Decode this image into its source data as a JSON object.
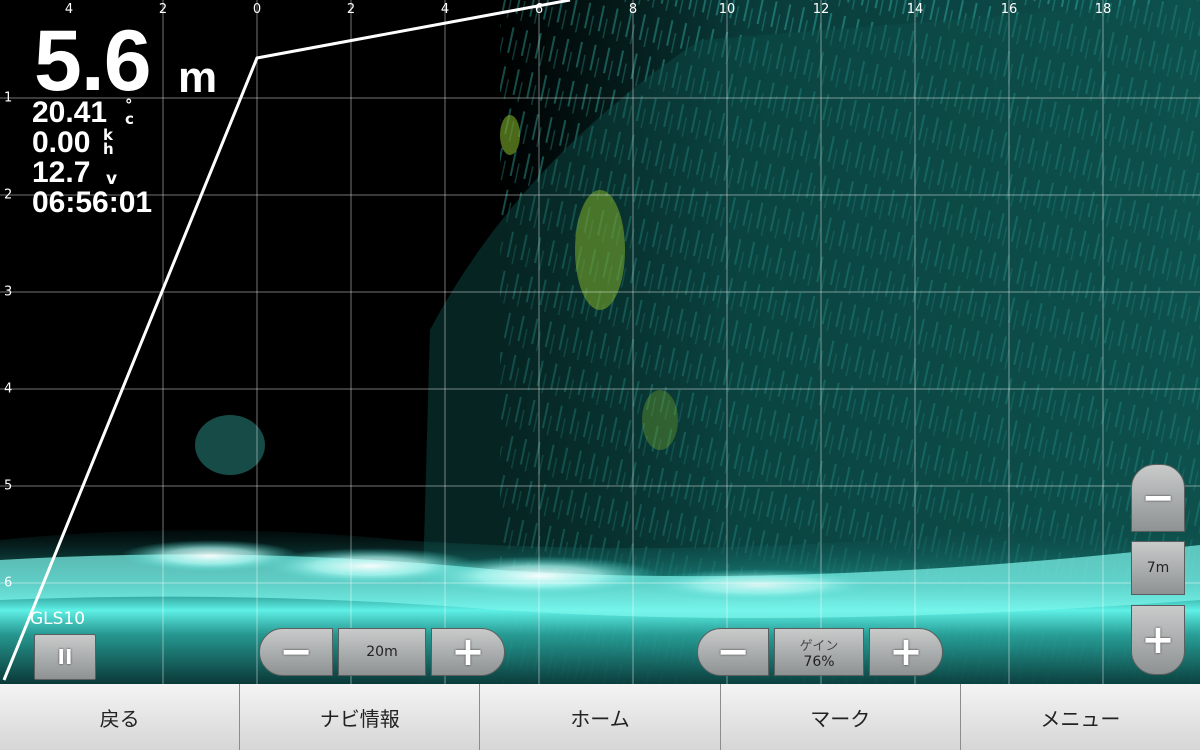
{
  "top_axis": {
    "ticks": [
      "4",
      "2",
      "0",
      "2",
      "4",
      "6",
      "8",
      "10",
      "12",
      "14",
      "16",
      "18"
    ]
  },
  "left_axis": {
    "ticks": [
      "1",
      "2",
      "3",
      "4",
      "5",
      "6"
    ]
  },
  "readouts": {
    "depth_value": "5.6",
    "depth_unit": "m",
    "temperature_value": "20.41",
    "temperature_unit_top": "°",
    "temperature_unit_bottom": "c",
    "speed_value": "0.00",
    "speed_unit_top": "k",
    "speed_unit_bottom": "h",
    "voltage_value": "12.7",
    "voltage_unit": "v",
    "time": "06:56:01"
  },
  "transducer": {
    "name": "GLS10",
    "pause_symbol": "II"
  },
  "range_control": {
    "minus": "−",
    "value": "20m",
    "plus": "+"
  },
  "gain_control": {
    "minus": "−",
    "label": "ゲイン",
    "value": "76%",
    "plus": "+"
  },
  "zoom_control": {
    "minus": "−",
    "value": "7m",
    "plus": "+"
  },
  "bottom_nav": [
    "戻る",
    "ナビ情報",
    "ホーム",
    "マーク",
    "メニュー"
  ],
  "colors": {
    "echo": "#3fd6cc",
    "echo_strong": "#e8fffd",
    "echo_weak": "#0c3a3a",
    "fish": "#7fae2a",
    "grid": "#ffffff"
  }
}
